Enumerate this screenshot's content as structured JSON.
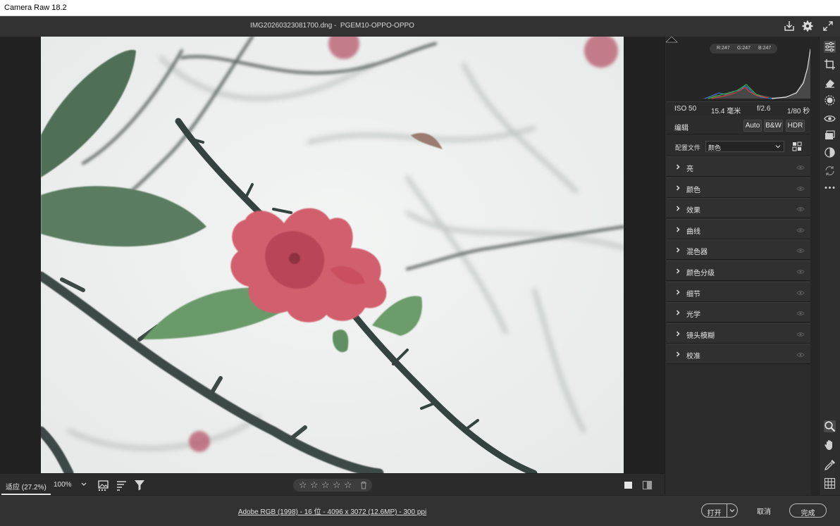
{
  "window": {
    "title": "Camera Raw 18.2"
  },
  "header": {
    "filename": "IMG20260323081700.dng -  PGEM10-OPPO-OPPO",
    "save_icon": "download-icon",
    "settings_icon": "gear-icon",
    "fullscreen_icon": "expand-icon"
  },
  "histogram": {
    "r_label": "R:247",
    "g_label": "G:247",
    "b_label": "B:247",
    "shadow_clip_icon": "shadow-clipping-icon",
    "highlight_clip_icon": "highlight-clipping-icon"
  },
  "exif": {
    "iso": "ISO 50",
    "focal": "15.4 毫米",
    "aperture": "f/2.6",
    "shutter": "1/80 秒"
  },
  "edit": {
    "title": "编辑",
    "auto": "Auto",
    "bw": "B&W",
    "hdr": "HDR"
  },
  "profile": {
    "label": "配置文件",
    "value": "颜色",
    "browse_icon": "grid-icon"
  },
  "sections": [
    {
      "label": "亮"
    },
    {
      "label": "颜色"
    },
    {
      "label": "效果"
    },
    {
      "label": "曲线"
    },
    {
      "label": "混色器"
    },
    {
      "label": "颜色分级"
    },
    {
      "label": "细节"
    },
    {
      "label": "光学"
    },
    {
      "label": "镜头模糊"
    },
    {
      "label": "校准"
    }
  ],
  "viewbar": {
    "fit_zoom": "适应 (27.2%)",
    "zoom_100": "100%",
    "rating_stars": 0
  },
  "status": {
    "workflow": "Adobe RGB (1998) - 16 位 - 4096 x 3072 (12.6MP) - 300 ppi",
    "open": "打开",
    "cancel": "取消",
    "done": "完成"
  },
  "tools": [
    "edit-sliders-icon",
    "crop-icon",
    "eraser-icon",
    "masking-icon",
    "red-eye-icon",
    "snapshots-icon",
    "presets-icon",
    "sync-icon",
    "more-icon"
  ],
  "colors": {
    "background": "#323232",
    "panel": "#2c2c2c",
    "accent_white": "#ffffff"
  }
}
